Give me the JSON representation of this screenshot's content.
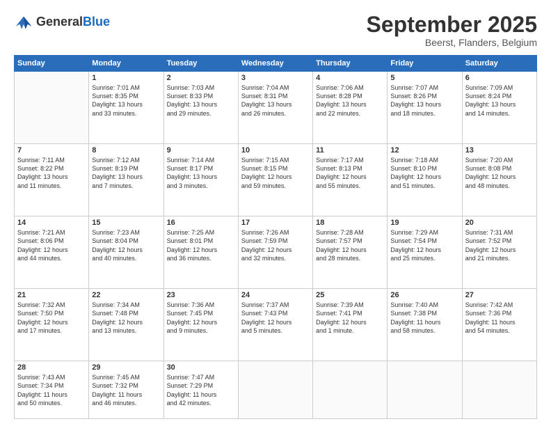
{
  "header": {
    "logo_line1": "General",
    "logo_line2": "Blue",
    "month": "September 2025",
    "location": "Beerst, Flanders, Belgium"
  },
  "weekdays": [
    "Sunday",
    "Monday",
    "Tuesday",
    "Wednesday",
    "Thursday",
    "Friday",
    "Saturday"
  ],
  "weeks": [
    [
      {
        "day": "",
        "text": ""
      },
      {
        "day": "1",
        "text": "Sunrise: 7:01 AM\nSunset: 8:35 PM\nDaylight: 13 hours\nand 33 minutes."
      },
      {
        "day": "2",
        "text": "Sunrise: 7:03 AM\nSunset: 8:33 PM\nDaylight: 13 hours\nand 29 minutes."
      },
      {
        "day": "3",
        "text": "Sunrise: 7:04 AM\nSunset: 8:31 PM\nDaylight: 13 hours\nand 26 minutes."
      },
      {
        "day": "4",
        "text": "Sunrise: 7:06 AM\nSunset: 8:28 PM\nDaylight: 13 hours\nand 22 minutes."
      },
      {
        "day": "5",
        "text": "Sunrise: 7:07 AM\nSunset: 8:26 PM\nDaylight: 13 hours\nand 18 minutes."
      },
      {
        "day": "6",
        "text": "Sunrise: 7:09 AM\nSunset: 8:24 PM\nDaylight: 13 hours\nand 14 minutes."
      }
    ],
    [
      {
        "day": "7",
        "text": "Sunrise: 7:11 AM\nSunset: 8:22 PM\nDaylight: 13 hours\nand 11 minutes."
      },
      {
        "day": "8",
        "text": "Sunrise: 7:12 AM\nSunset: 8:19 PM\nDaylight: 13 hours\nand 7 minutes."
      },
      {
        "day": "9",
        "text": "Sunrise: 7:14 AM\nSunset: 8:17 PM\nDaylight: 13 hours\nand 3 minutes."
      },
      {
        "day": "10",
        "text": "Sunrise: 7:15 AM\nSunset: 8:15 PM\nDaylight: 12 hours\nand 59 minutes."
      },
      {
        "day": "11",
        "text": "Sunrise: 7:17 AM\nSunset: 8:13 PM\nDaylight: 12 hours\nand 55 minutes."
      },
      {
        "day": "12",
        "text": "Sunrise: 7:18 AM\nSunset: 8:10 PM\nDaylight: 12 hours\nand 51 minutes."
      },
      {
        "day": "13",
        "text": "Sunrise: 7:20 AM\nSunset: 8:08 PM\nDaylight: 12 hours\nand 48 minutes."
      }
    ],
    [
      {
        "day": "14",
        "text": "Sunrise: 7:21 AM\nSunset: 8:06 PM\nDaylight: 12 hours\nand 44 minutes."
      },
      {
        "day": "15",
        "text": "Sunrise: 7:23 AM\nSunset: 8:04 PM\nDaylight: 12 hours\nand 40 minutes."
      },
      {
        "day": "16",
        "text": "Sunrise: 7:25 AM\nSunset: 8:01 PM\nDaylight: 12 hours\nand 36 minutes."
      },
      {
        "day": "17",
        "text": "Sunrise: 7:26 AM\nSunset: 7:59 PM\nDaylight: 12 hours\nand 32 minutes."
      },
      {
        "day": "18",
        "text": "Sunrise: 7:28 AM\nSunset: 7:57 PM\nDaylight: 12 hours\nand 28 minutes."
      },
      {
        "day": "19",
        "text": "Sunrise: 7:29 AM\nSunset: 7:54 PM\nDaylight: 12 hours\nand 25 minutes."
      },
      {
        "day": "20",
        "text": "Sunrise: 7:31 AM\nSunset: 7:52 PM\nDaylight: 12 hours\nand 21 minutes."
      }
    ],
    [
      {
        "day": "21",
        "text": "Sunrise: 7:32 AM\nSunset: 7:50 PM\nDaylight: 12 hours\nand 17 minutes."
      },
      {
        "day": "22",
        "text": "Sunrise: 7:34 AM\nSunset: 7:48 PM\nDaylight: 12 hours\nand 13 minutes."
      },
      {
        "day": "23",
        "text": "Sunrise: 7:36 AM\nSunset: 7:45 PM\nDaylight: 12 hours\nand 9 minutes."
      },
      {
        "day": "24",
        "text": "Sunrise: 7:37 AM\nSunset: 7:43 PM\nDaylight: 12 hours\nand 5 minutes."
      },
      {
        "day": "25",
        "text": "Sunrise: 7:39 AM\nSunset: 7:41 PM\nDaylight: 12 hours\nand 1 minute."
      },
      {
        "day": "26",
        "text": "Sunrise: 7:40 AM\nSunset: 7:38 PM\nDaylight: 11 hours\nand 58 minutes."
      },
      {
        "day": "27",
        "text": "Sunrise: 7:42 AM\nSunset: 7:36 PM\nDaylight: 11 hours\nand 54 minutes."
      }
    ],
    [
      {
        "day": "28",
        "text": "Sunrise: 7:43 AM\nSunset: 7:34 PM\nDaylight: 11 hours\nand 50 minutes."
      },
      {
        "day": "29",
        "text": "Sunrise: 7:45 AM\nSunset: 7:32 PM\nDaylight: 11 hours\nand 46 minutes."
      },
      {
        "day": "30",
        "text": "Sunrise: 7:47 AM\nSunset: 7:29 PM\nDaylight: 11 hours\nand 42 minutes."
      },
      {
        "day": "",
        "text": ""
      },
      {
        "day": "",
        "text": ""
      },
      {
        "day": "",
        "text": ""
      },
      {
        "day": "",
        "text": ""
      }
    ]
  ]
}
